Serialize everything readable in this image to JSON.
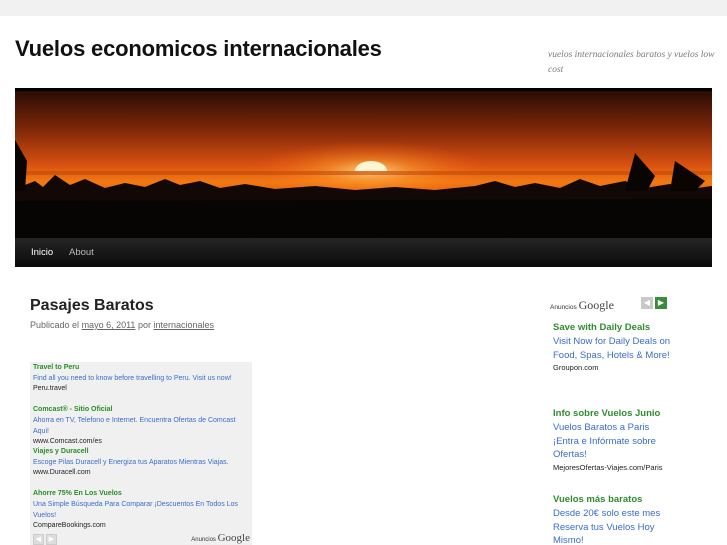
{
  "site": {
    "title": "Vuelos economicos internacionales",
    "description": "vuelos internacionales baratos y vuelos low cost"
  },
  "nav": {
    "items": [
      {
        "label": "Inicio",
        "active": true
      },
      {
        "label": "About",
        "active": false
      }
    ]
  },
  "post": {
    "title": "Pasajes Baratos",
    "meta_prefix": "Publicado el",
    "date": "mayo 6, 2011",
    "meta_by": "por",
    "author": "internacionales"
  },
  "inline_ads": {
    "items": [
      {
        "title": "Travel to Peru",
        "desc": "Find all you need to know before travelling to Peru. Visit us now!",
        "url": "Peru.travel"
      },
      {
        "title": "Comcast® - Sitio Oficial",
        "desc": "Ahorra en TV, Telefono e Internet. Encuentra Ofertas de Comcast Aqui!",
        "url": "www.Comcast.com/es"
      },
      {
        "title": "Viajes y Duracell",
        "desc": "Escoge Pilas Duracell y Energiza tus Aparatos Mientras Viajas.",
        "url": "www.Duracell.com"
      },
      {
        "title": "Ahorre 75% En Los Vuelos",
        "desc": "Una Simple Búsqueda Para Comparar ¡Descuentos En Todos Los Vuelos!",
        "url": "CompareBookings.com"
      }
    ],
    "ads_by": "Anuncios",
    "google": "Google"
  },
  "sidebar_ads": {
    "ads_by": "Anuncios",
    "google": "Google",
    "prev_icon": "◀",
    "next_icon": "▶",
    "items": [
      {
        "title": "Save with Daily Deals",
        "desc": "Visit Now for Daily Deals on Food, Spas, Hotels & More!",
        "url": "Groupon.com"
      },
      {
        "title": "Info sobre Vuelos Junio",
        "desc": "Vuelos Baratos a Paris ¡Entra e Infórmate sobre Ofertas!",
        "url": "MejoresOfertas-Viajes.com/Paris"
      },
      {
        "title": "Vuelos más baratos",
        "desc": "Desde 20€ solo este mes Reserva tus Vuelos Hoy Mismo!",
        "url": ""
      }
    ]
  },
  "colors": {
    "ad_title": "#2a8c2a",
    "ad_desc": "#3a6ccc",
    "nav_bg": "#111111"
  }
}
